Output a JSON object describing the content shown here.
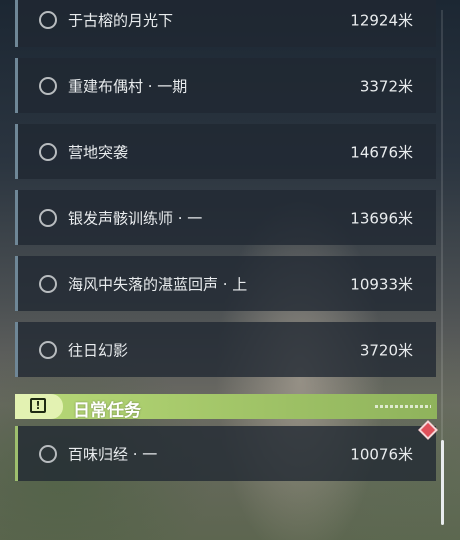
{
  "quests": [
    {
      "name": "于古榕的月光下",
      "distance": "12924米"
    },
    {
      "name": "重建布偶村 · 一期",
      "distance": "3372米"
    },
    {
      "name": "营地突袭",
      "distance": "14676米"
    },
    {
      "name": "银发声骸训练师 · 一",
      "distance": "13696米"
    },
    {
      "name": "海风中失落的湛蓝回声 · 上",
      "distance": "10933米"
    },
    {
      "name": "往日幻影",
      "distance": "3720米"
    }
  ],
  "daily_section": {
    "title": "日常任务",
    "icon": "exclamation-icon",
    "items": [
      {
        "name": "百味归经 · 一",
        "distance": "10076米"
      }
    ]
  },
  "colors": {
    "quest_bar": "#6f8797",
    "daily_bar": "#9ebf6e",
    "daily_header": "#a5c86a",
    "alert_marker": "#e0505a"
  }
}
